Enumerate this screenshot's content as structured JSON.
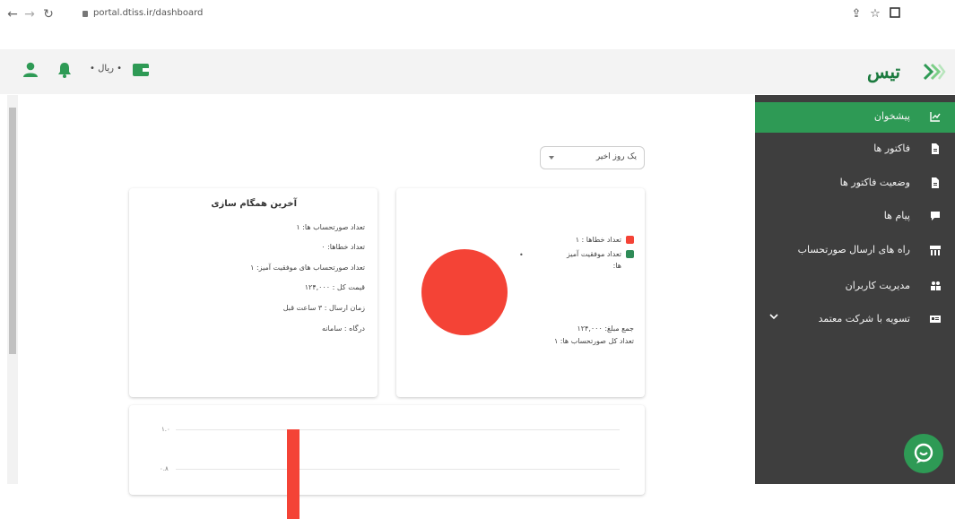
{
  "browser": {
    "url": "portal.dtiss.ir/dashboard"
  },
  "header": {
    "currency_label": "• ریال •",
    "logo_text": "تیس"
  },
  "sidebar": {
    "items": [
      {
        "label": "پیشخوان",
        "active": true
      },
      {
        "label": "فاکتور ها"
      },
      {
        "label": "وضعیت فاکتور ها"
      },
      {
        "label": "پیام ها"
      },
      {
        "label": "راه های ارسال صورتحساب"
      },
      {
        "label": "مدیریت کاربران"
      },
      {
        "label": "تسویه با شرکت معتمد"
      }
    ]
  },
  "filter": {
    "selected": "یک روز اخیر"
  },
  "pie_card": {
    "legend": [
      {
        "label": "تعداد خطاها : ۱",
        "color": "#f44336"
      },
      {
        "label": "تعداد موفقیت آمیز",
        "label2": "ها:",
        "color": "#2e8b57"
      }
    ],
    "total_amount": "جمع مبلغ: ۱۲۴,۰۰۰",
    "total_invoices": "تعداد کل صورتحساب ها: ۱"
  },
  "sync_card": {
    "title": "آخرین همگام سازی",
    "lines": [
      "تعداد صورتحساب ها: ۱",
      "تعداد خطاها: ۰",
      "تعداد صورتحساب های موفقیت آمیز: ۱",
      "قیمت کل : ۱۲۴,۰۰۰",
      "زمان ارسال : ۳ ساعت قبل",
      "درگاه : سامانه"
    ]
  },
  "chart_data": {
    "type": "bar",
    "ticks": [
      "۱.۰",
      "۰.۸"
    ],
    "values": [
      1
    ],
    "color": "#f44336"
  },
  "colors": {
    "brand_green": "#2e9a55",
    "sidebar_bg": "#3e3e3e",
    "error_red": "#f44336"
  }
}
